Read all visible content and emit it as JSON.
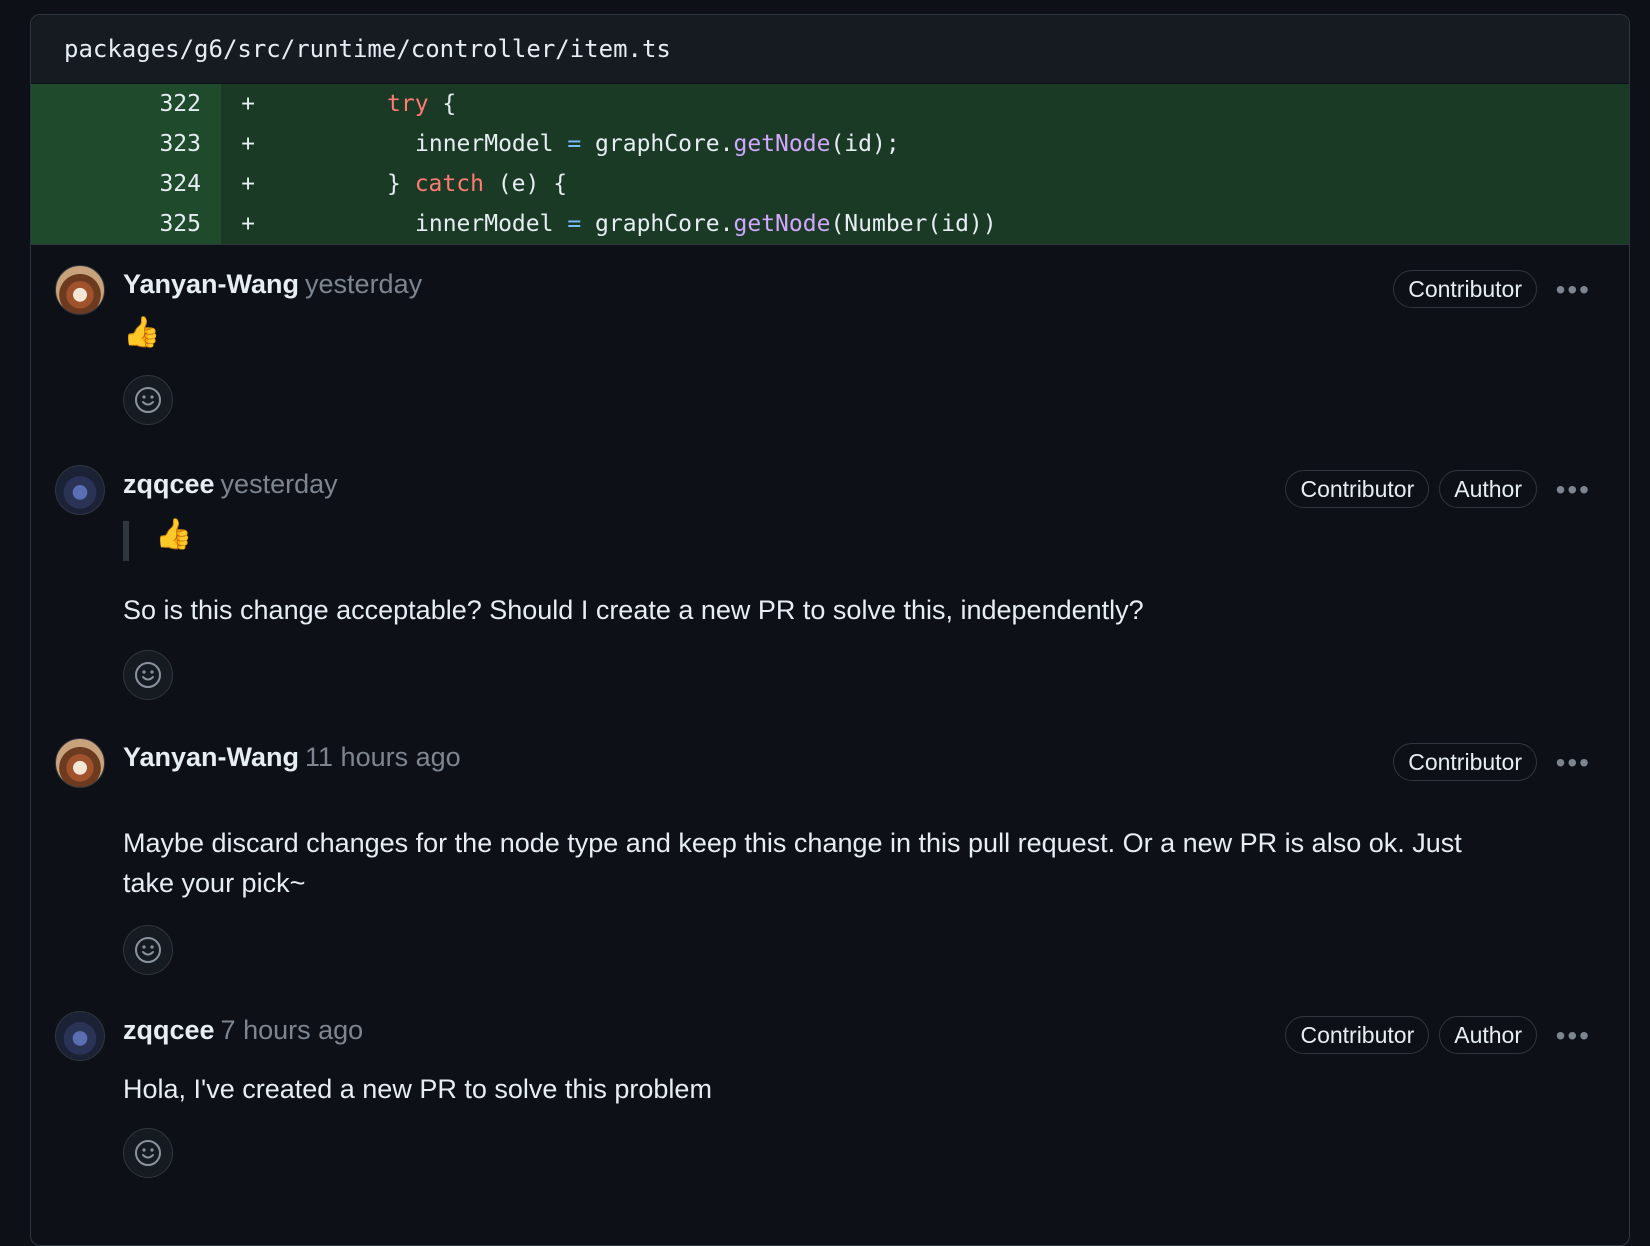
{
  "file": {
    "path": "packages/g6/src/runtime/controller/item.ts"
  },
  "diff_lines": [
    {
      "num": "322",
      "sign": "+"
    },
    {
      "num": "323",
      "sign": "+"
    },
    {
      "num": "324",
      "sign": "+"
    },
    {
      "num": "325",
      "sign": "+"
    }
  ],
  "code": {
    "l322_kw": "try",
    "l322_rest": " {",
    "l323_a": "innerModel ",
    "l323_op": "=",
    "l323_b": " graphCore.",
    "l323_fn": "getNode",
    "l323_c": "(id);",
    "l324_a": "} ",
    "l324_kw": "catch",
    "l324_b": " (e) {",
    "l325_a": "innerModel ",
    "l325_op": "=",
    "l325_b": " graphCore.",
    "l325_fn": "getNode",
    "l325_c": "(Number(id))"
  },
  "comments": [
    {
      "author": "Yanyan-Wang",
      "time": "yesterday",
      "badges": [
        "Contributor"
      ],
      "body": "👍"
    },
    {
      "author": "zqqcee",
      "time": "yesterday",
      "badges": [
        "Contributor",
        "Author"
      ],
      "quote": "👍",
      "body": "So is this change acceptable?  Should I create a new PR to solve this, independently?"
    },
    {
      "author": "Yanyan-Wang",
      "time": "11 hours ago",
      "badges": [
        "Contributor"
      ],
      "body": "Maybe discard changes for the node type and keep this change in this pull request. Or a new PR is also ok. Just take your pick~"
    },
    {
      "author": "zqqcee",
      "time": "7 hours ago",
      "badges": [
        "Contributor",
        "Author"
      ],
      "body": "Hola, I've created a new PR to solve this problem"
    }
  ],
  "ui": {
    "more_glyph": "•••"
  }
}
